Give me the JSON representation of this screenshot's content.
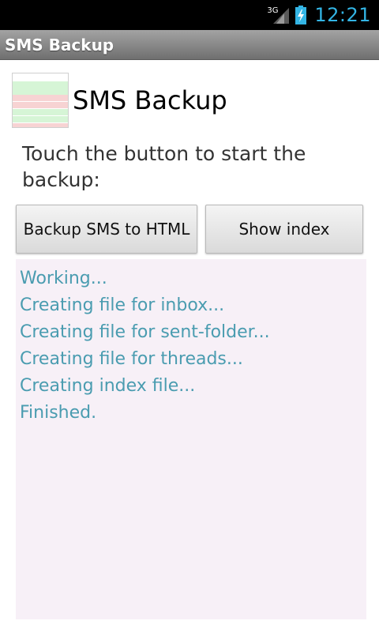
{
  "status_bar": {
    "network": "3G",
    "time": "12:21",
    "icons": [
      "signal-icon",
      "battery-charging-icon"
    ]
  },
  "title_bar": {
    "title": "SMS Backup"
  },
  "header": {
    "app_name": "SMS Backup",
    "icon": "sms-backup-app-icon"
  },
  "prompt": "Touch the button to start the backup:",
  "buttons": {
    "backup_label": "Backup SMS to HTML",
    "index_label": "Show index"
  },
  "log": {
    "lines": [
      "Working...",
      "Creating file for inbox...",
      "Creating file for sent-folder...",
      "Creating file for threads...",
      "Creating index file...",
      "Finished."
    ]
  },
  "colors": {
    "status_accent": "#33b5e5",
    "log_text": "#4a9cb0",
    "log_background": "#f7f0f7"
  }
}
